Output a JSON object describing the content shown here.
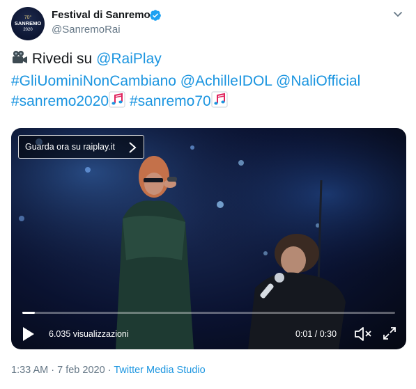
{
  "account": {
    "display_name": "Festival di Sanremo",
    "handle": "@SanremoRai",
    "avatar_text": [
      "70°",
      "SANREMO",
      "2020"
    ],
    "verified_icon": "verified-badge-icon"
  },
  "tweet": {
    "line1": {
      "emoji": "movie-camera-icon",
      "word": "Rivedi su",
      "mention": "@RaiPlay"
    },
    "line2": {
      "hashtag": "#GliUominiNonCambiano",
      "mention1": "@AchilleIDOL",
      "mention2": "@NaliOfficial"
    },
    "line3": {
      "hashtag1": "#sanremo2020",
      "hashtag2": "#sanremo70",
      "emoji": "sanremo-note-icon"
    }
  },
  "video": {
    "promo_label": "Guarda ora su raiplay.it",
    "views": "6.035 visualizzazioni",
    "time": "0:01 / 0:30",
    "progress": 0.033
  },
  "meta": {
    "time": "1:33 AM",
    "separator": "·",
    "date": "7 feb 2020",
    "source": "Twitter Media Studio"
  },
  "colors": {
    "link": "#1b95e0",
    "text": "#14171a",
    "secondary": "#657786",
    "verified": "#1da1f2",
    "note_red": "#e0245e"
  }
}
